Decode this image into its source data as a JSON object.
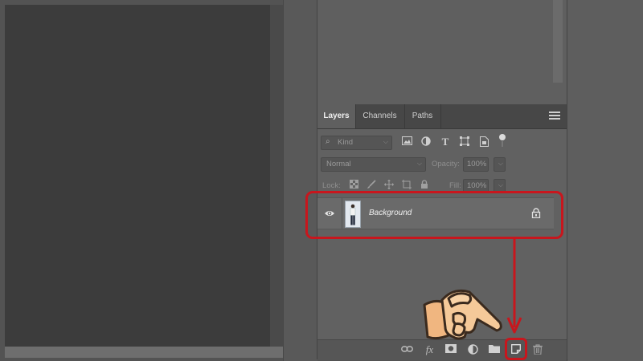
{
  "tabs": [
    "Layers",
    "Channels",
    "Paths"
  ],
  "filter": {
    "label": "Kind"
  },
  "blend_mode": "Normal",
  "opacity": {
    "label": "Opacity:",
    "value": "100%"
  },
  "lock": {
    "label": "Lock:"
  },
  "fill": {
    "label": "Fill:",
    "value": "100%"
  },
  "layers": [
    {
      "name": "Background",
      "visible": true,
      "locked": true
    }
  ],
  "filter_icons": [
    "image-filter-icon",
    "adjustment-filter-icon",
    "type-filter-icon",
    "shape-filter-icon",
    "smart-object-filter-icon",
    "filter-toggle-icon"
  ],
  "lock_icons": [
    "lock-transparent-icon",
    "lock-paint-icon",
    "lock-position-icon",
    "lock-artboard-icon",
    "lock-all-icon"
  ],
  "bottom_icons": [
    "link-layers-icon",
    "fx-icon",
    "add-mask-icon",
    "adjustment-layer-icon",
    "new-group-icon",
    "new-layer-icon",
    "delete-layer-icon"
  ],
  "highlight_color": "#c8161d"
}
